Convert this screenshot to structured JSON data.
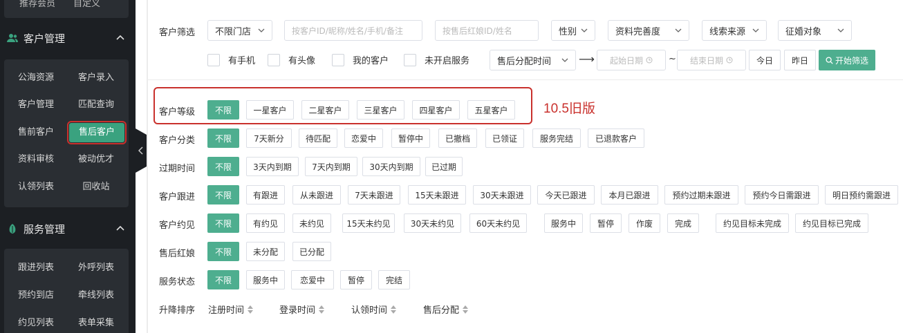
{
  "sidebar": {
    "top_row_left": "推荐会员",
    "top_row_right": "自定义",
    "customer_section": {
      "title": "客户管理",
      "items": [
        "公海资源",
        "客户录入",
        "客户管理",
        "匹配查询",
        "售前客户",
        "售后客户",
        "资料审核",
        "被动优才",
        "认领列表",
        "回收站"
      ],
      "active": "售后客户"
    },
    "service_section": {
      "title": "服务管理",
      "items": [
        "跟进列表",
        "外呼列表",
        "预约到店",
        "牵线列表",
        "约见列表",
        "表单采集"
      ]
    }
  },
  "filters": {
    "label": "客户筛选",
    "store_select": "不限门店",
    "customer_search_placeholder": "按客户ID/昵称/姓名/手机/备注",
    "matchmaker_search_placeholder": "按售后红娘ID/姓名",
    "gender_select": "性别",
    "completeness_select": "资料完善度",
    "lead_source_select": "线索来源",
    "marriage_target_select": "征婚对象",
    "checkboxes": [
      "有手机",
      "有头像",
      "我的客户",
      "未开启服务"
    ],
    "assign_time_select": "售后分配时间",
    "arrow": "⟶",
    "start_date_placeholder": "起始日期",
    "tilde": "~",
    "end_date_placeholder": "结束日期",
    "today_button": "今日",
    "yesterday_button": "昨日",
    "start_filter_button": "开始筛选"
  },
  "rows": {
    "level": {
      "label": "客户等级",
      "options": [
        "不限",
        "一星客户",
        "二星客户",
        "三星客户",
        "四星客户",
        "五星客户"
      ]
    },
    "category": {
      "label": "客户分类",
      "options": [
        "不限",
        "7天新分",
        "待匹配",
        "恋爱中",
        "暂停中",
        "已撤档",
        "已领证",
        "服务完结",
        "已退款客户"
      ]
    },
    "expire": {
      "label": "过期时间",
      "options": [
        "不限",
        "3天内到期",
        "7天内到期",
        "30天内到期",
        "已过期"
      ]
    },
    "followup": {
      "label": "客户跟进",
      "options": [
        "不限",
        "有跟进",
        "从未跟进",
        "7天未跟进",
        "15天未跟进",
        "30天未跟进",
        "今天已跟进",
        "本月已跟进",
        "预约过期未跟进",
        "预约今日需跟进",
        "明日预约需跟进"
      ]
    },
    "meeting": {
      "label": "客户约见",
      "options": [
        "不限",
        "有约见",
        "未约见",
        "15天未约见",
        "30天未约见",
        "60天未约见",
        "服务中",
        "暂停",
        "作废",
        "完成",
        "约见目标未完成",
        "约见目标已完成"
      ]
    },
    "matchmaker": {
      "label": "售后红娘",
      "options": [
        "不限",
        "未分配",
        "已分配"
      ]
    },
    "service_status": {
      "label": "服务状态",
      "options": [
        "不限",
        "服务中",
        "恋爱中",
        "暂停",
        "完结"
      ]
    }
  },
  "sorting": {
    "label": "升降排序",
    "fields": [
      "注册时间",
      "登录时间",
      "认领时间",
      "售后分配"
    ]
  },
  "version_note": "10.5旧版",
  "colors": {
    "accent": "#4eae8f",
    "highlight_red": "#c9302c",
    "sidebar_bg": "#1c1f23",
    "sidebar_panel": "#2a2e33"
  }
}
